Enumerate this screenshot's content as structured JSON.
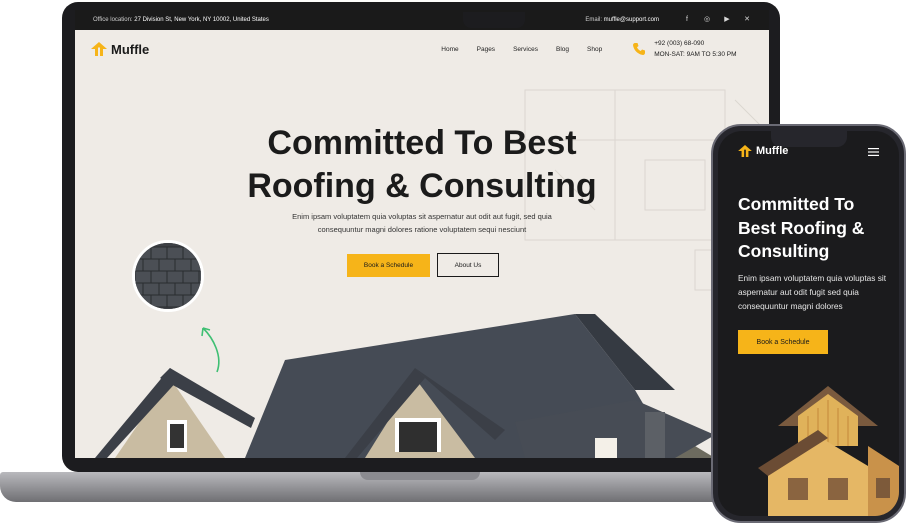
{
  "topbar": {
    "address_label": "Office location:",
    "address": "27 Division St, New York, NY 10002, United States",
    "email_label": "Email:",
    "email": "muffle@support.com",
    "socials": [
      "facebook-icon",
      "instagram-icon",
      "youtube-icon",
      "twitter-icon"
    ]
  },
  "brand": {
    "name": "Muffle",
    "accent": "#f6b419"
  },
  "nav": {
    "items": [
      "Home",
      "Pages",
      "Services",
      "Blog",
      "Shop"
    ],
    "phone": "+92 (003) 68-090",
    "hours": "MON-SAT: 9AM TO 5:30 PM"
  },
  "hero": {
    "title_line1": "Committed To Best",
    "title_line2": "Roofing & Consulting",
    "text_line1": "Enim ipsam voluptatem quia voluptas sit aspernatur aut odit aut fugit, sed quia",
    "text_line2": "consequuntur magni dolores ratione voluptatem sequi nesciunt",
    "primary_button": "Book a Schedule",
    "secondary_button": "About Us"
  },
  "mobile": {
    "title": "Committed To Best Roofing & Consulting",
    "text": "Enim ipsam voluptatem quia voluptas sit aspernatur aut odit fugit sed quia consequuntur magni dolores",
    "button": "Book a Schedule"
  }
}
